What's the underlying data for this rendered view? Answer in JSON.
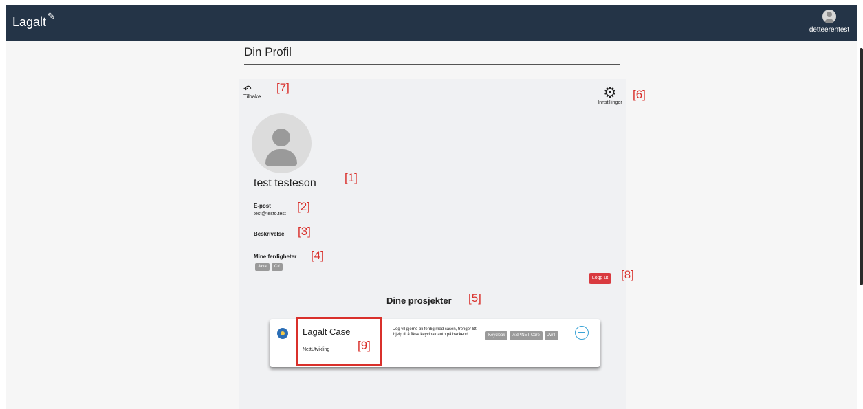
{
  "app": {
    "brand": "Lagalt",
    "brand_edit_icon": "pencil-icon"
  },
  "user": {
    "username": "detteerentest",
    "avatar_icon": "user-avatar-icon"
  },
  "page": {
    "title": "Din Profil"
  },
  "navigation": {
    "back_label": "Tilbake",
    "back_icon": "undo-arrow-icon",
    "settings_label": "Innstillinger",
    "settings_icon": "gear-icon"
  },
  "profile": {
    "name": "test testeson",
    "email_label": "E-post",
    "email": "test@testo.test",
    "description_label": "Beskrivelse",
    "skills_label": "Mine ferdigheter",
    "skills": [
      "Java",
      "C#"
    ]
  },
  "logout_label": "Logg ut",
  "projects": {
    "section_title": "Dine prosjekter",
    "items": [
      {
        "title": "Lagalt Case",
        "category": "NettUtvikling",
        "description": "Jeg vil gjerne bli ferdig med casen, trenger litt hjelp til å fikse keycloak auth på backend.",
        "tags": [
          "Keycloak",
          "ASP.NET Core",
          "JWT"
        ],
        "icon": "project-logo-icon",
        "status_icon": "progress-circle-icon"
      }
    ]
  },
  "annotations": {
    "m1": "[1]",
    "m2": "[2]",
    "m3": "[3]",
    "m4": "[4]",
    "m5": "[5]",
    "m6": "[6]",
    "m7": "[7]",
    "m8": "[8]",
    "m9": "[9]"
  },
  "colors": {
    "topbar": "#243447",
    "logout": "#d93a3f",
    "annotation": "#d9302b",
    "chip": "#9a9a9a"
  }
}
